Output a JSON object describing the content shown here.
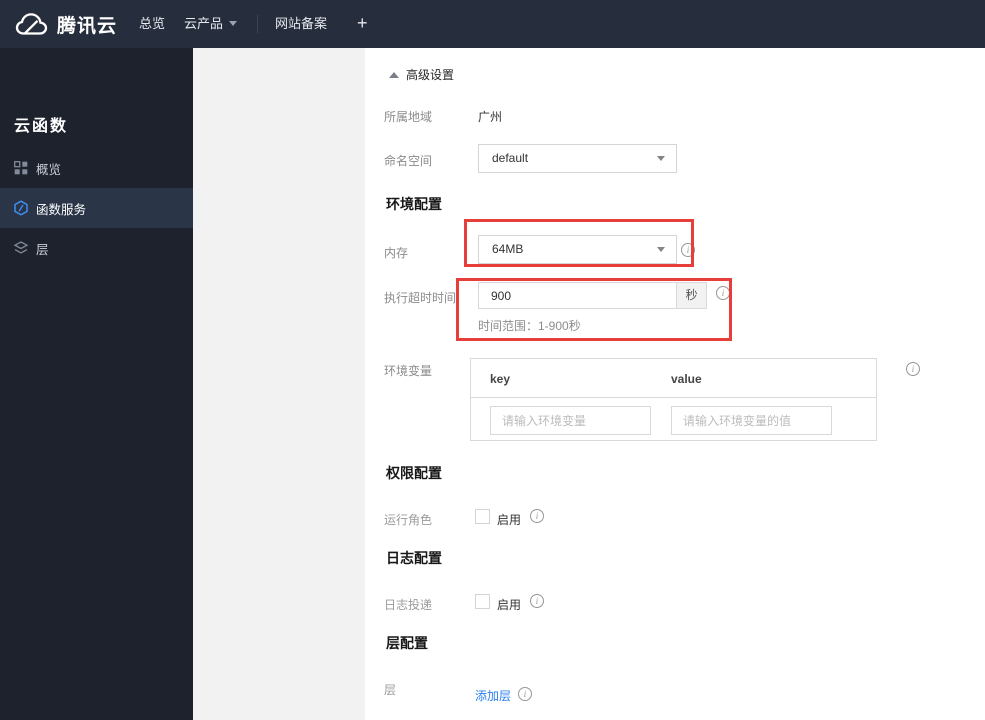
{
  "navbar": {
    "logo_text": "腾讯云",
    "overview": "总览",
    "products": "云产品",
    "icp": "网站备案",
    "plus": "+"
  },
  "sidebar": {
    "title": "云函数",
    "items": [
      {
        "label": "概览",
        "icon": "grid-icon",
        "active": false
      },
      {
        "label": "函数服务",
        "icon": "function-icon",
        "active": true
      },
      {
        "label": "层",
        "icon": "layers-icon",
        "active": false
      }
    ]
  },
  "content": {
    "advanced_settings": {
      "label": "高级设置"
    },
    "region": {
      "label": "所属地域",
      "value": "广州"
    },
    "namespace": {
      "label": "命名空间",
      "value": "default"
    },
    "section_env": "环境配置",
    "memory": {
      "label": "内存",
      "value": "64MB"
    },
    "timeout": {
      "label": "执行超时时间",
      "value": "900",
      "unit": "秒",
      "hint": "时间范围：1-900秒"
    },
    "env_vars": {
      "label": "环境变量",
      "key_header": "key",
      "value_header": "value",
      "key_placeholder": "请输入环境变量",
      "value_placeholder": "请输入环境变量的值"
    },
    "section_perm": "权限配置",
    "run_role": {
      "label": "运行角色",
      "enable_label": "启用"
    },
    "section_log": "日志配置",
    "log_delivery": {
      "label": "日志投递",
      "enable_label": "启用"
    },
    "section_layer": "层配置",
    "layer": {
      "label": "层",
      "add_link": "添加层"
    }
  },
  "icons": {
    "info": "i"
  },
  "colors": {
    "navbar_bg": "#262d3c",
    "sidebar_bg": "#1e222d",
    "sidebar_active_bg": "#2a3547",
    "highlight_red": "#e63f3b",
    "link_blue": "#2a7ff2",
    "function_icon_blue": "#3e8ef0"
  }
}
